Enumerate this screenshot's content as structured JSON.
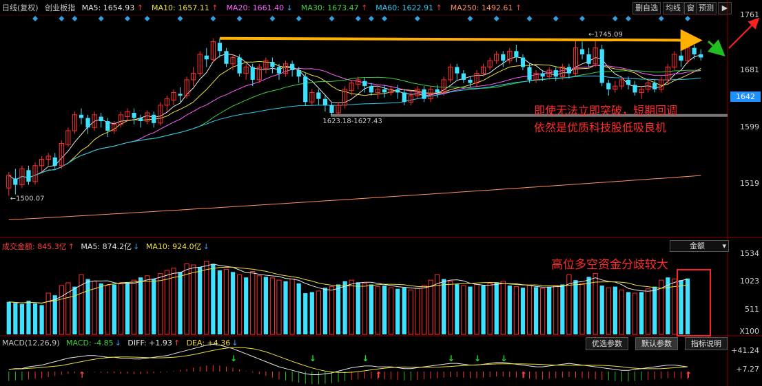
{
  "header": {
    "period": "日线(复权)",
    "symbol": "创业板指",
    "ma": [
      {
        "label": "MA5: 1654.93",
        "arrow": "↑",
        "color": "#e8e8e8"
      },
      {
        "label": "MA10: 1657.11",
        "arrow": "↑",
        "color": "#f0e040"
      },
      {
        "label": "MA20: 1661.40",
        "arrow": "↓",
        "color": "#ff60ff"
      },
      {
        "label": "MA30: 1673.47",
        "arrow": "↑",
        "color": "#40d040"
      },
      {
        "label": "MA60: 1622.91",
        "arrow": "↑",
        "color": "#30c8f0"
      },
      {
        "label": "MA250: 1492.61",
        "arrow": "↑",
        "color": "#ff9060"
      }
    ]
  },
  "toolbar": {
    "delete_self": "删自选",
    "ma_line": "均线",
    "window": "窗",
    "forecast": "预测"
  },
  "price_axis": {
    "ticks": [
      "1761",
      "1681",
      "1599",
      "1519"
    ],
    "current": "1642"
  },
  "volume_header": {
    "label": "成交金额: 845.3亿",
    "ma5": "MA5: 874.2亿",
    "ma10": "MA10: 924.0亿",
    "selector": "金额"
  },
  "volume_axis": {
    "ticks": [
      "1534",
      "1023",
      "511"
    ],
    "unit": "X100"
  },
  "macd_header": {
    "label": "MACD(12,26,9)",
    "macd": "MACD: -4.85",
    "diff": "DIFF: +1.93",
    "dea": "DEA: +4.36"
  },
  "macd_axis": {
    "ticks": [
      "+41.24",
      "+7.27"
    ]
  },
  "tabs": {
    "preferred": "优选参数",
    "default": "默认参数",
    "help": "指标说明"
  },
  "annotations": {
    "line1": "即使无法立即突破，短期回调",
    "line2": "依然是优质科技股低吸良机",
    "volume_note": "高位多空资金分歧较大"
  },
  "chart_data": {
    "type": "candlestick",
    "price_range": [
      1440,
      1775
    ],
    "labels": {
      "high": "1745.09",
      "low": "1500.07",
      "mid_low": "1623.18-1627.43"
    },
    "candles": [
      [
        1510,
        1530,
        1498,
        1535
      ],
      [
        1525,
        1515,
        1500,
        1540
      ],
      [
        1515,
        1540,
        1510,
        1545
      ],
      [
        1538,
        1520,
        1515,
        1545
      ],
      [
        1520,
        1545,
        1515,
        1550
      ],
      [
        1545,
        1555,
        1535,
        1560
      ],
      [
        1555,
        1560,
        1545,
        1565
      ],
      [
        1558,
        1545,
        1540,
        1565
      ],
      [
        1545,
        1580,
        1540,
        1585
      ],
      [
        1578,
        1600,
        1575,
        1605
      ],
      [
        1600,
        1625,
        1595,
        1630
      ],
      [
        1625,
        1620,
        1610,
        1635
      ],
      [
        1620,
        1605,
        1595,
        1625
      ],
      [
        1605,
        1625,
        1600,
        1630
      ],
      [
        1622,
        1615,
        1605,
        1628
      ],
      [
        1615,
        1600,
        1590,
        1620
      ],
      [
        1600,
        1610,
        1595,
        1615
      ],
      [
        1610,
        1625,
        1605,
        1630
      ],
      [
        1622,
        1630,
        1615,
        1635
      ],
      [
        1628,
        1620,
        1610,
        1635
      ],
      [
        1620,
        1615,
        1605,
        1625
      ],
      [
        1615,
        1628,
        1610,
        1632
      ],
      [
        1625,
        1612,
        1605,
        1630
      ],
      [
        1612,
        1640,
        1608,
        1645
      ],
      [
        1640,
        1650,
        1630,
        1655
      ],
      [
        1648,
        1660,
        1640,
        1665
      ],
      [
        1658,
        1655,
        1645,
        1668
      ],
      [
        1655,
        1680,
        1650,
        1685
      ],
      [
        1680,
        1690,
        1670,
        1700
      ],
      [
        1690,
        1720,
        1685,
        1725
      ],
      [
        1718,
        1712,
        1700,
        1730
      ],
      [
        1712,
        1740,
        1708,
        1745
      ],
      [
        1738,
        1725,
        1715,
        1745
      ],
      [
        1725,
        1705,
        1700,
        1730
      ],
      [
        1705,
        1715,
        1695,
        1720
      ],
      [
        1715,
        1690,
        1685,
        1720
      ],
      [
        1690,
        1700,
        1680,
        1705
      ],
      [
        1700,
        1680,
        1670,
        1705
      ],
      [
        1680,
        1700,
        1675,
        1705
      ],
      [
        1698,
        1710,
        1690,
        1715
      ],
      [
        1708,
        1700,
        1690,
        1715
      ],
      [
        1700,
        1690,
        1680,
        1705
      ],
      [
        1690,
        1705,
        1685,
        1710
      ],
      [
        1705,
        1695,
        1685,
        1710
      ],
      [
        1695,
        1685,
        1675,
        1700
      ],
      [
        1685,
        1645,
        1640,
        1690
      ],
      [
        1645,
        1660,
        1640,
        1665
      ],
      [
        1660,
        1650,
        1640,
        1665
      ],
      [
        1650,
        1640,
        1630,
        1655
      ],
      [
        1640,
        1628,
        1625,
        1645
      ],
      [
        1628,
        1640,
        1623,
        1645
      ],
      [
        1640,
        1665,
        1635,
        1670
      ],
      [
        1663,
        1675,
        1655,
        1680
      ],
      [
        1673,
        1680,
        1665,
        1685
      ],
      [
        1678,
        1670,
        1660,
        1683
      ],
      [
        1670,
        1660,
        1655,
        1675
      ],
      [
        1660,
        1665,
        1650,
        1670
      ],
      [
        1665,
        1660,
        1652,
        1672
      ],
      [
        1660,
        1665,
        1655,
        1670
      ],
      [
        1665,
        1660,
        1650,
        1672
      ],
      [
        1660,
        1645,
        1640,
        1665
      ],
      [
        1645,
        1655,
        1640,
        1660
      ],
      [
        1655,
        1665,
        1650,
        1670
      ],
      [
        1665,
        1650,
        1645,
        1670
      ],
      [
        1650,
        1665,
        1645,
        1670
      ],
      [
        1665,
        1660,
        1652,
        1672
      ],
      [
        1660,
        1680,
        1655,
        1685
      ],
      [
        1680,
        1700,
        1675,
        1705
      ],
      [
        1700,
        1690,
        1680,
        1705
      ],
      [
        1690,
        1680,
        1675,
        1695
      ],
      [
        1680,
        1675,
        1668,
        1685
      ],
      [
        1675,
        1690,
        1670,
        1695
      ],
      [
        1690,
        1700,
        1685,
        1705
      ],
      [
        1700,
        1710,
        1695,
        1715
      ],
      [
        1710,
        1720,
        1705,
        1725
      ],
      [
        1720,
        1710,
        1700,
        1725
      ],
      [
        1710,
        1725,
        1705,
        1730
      ],
      [
        1725,
        1715,
        1708,
        1735
      ],
      [
        1715,
        1700,
        1695,
        1720
      ],
      [
        1700,
        1680,
        1675,
        1705
      ],
      [
        1680,
        1690,
        1675,
        1695
      ],
      [
        1690,
        1685,
        1678,
        1695
      ],
      [
        1685,
        1695,
        1680,
        1700
      ],
      [
        1695,
        1685,
        1678,
        1700
      ],
      [
        1685,
        1700,
        1680,
        1705
      ],
      [
        1700,
        1690,
        1682,
        1705
      ],
      [
        1690,
        1730,
        1685,
        1745
      ],
      [
        1728,
        1720,
        1712,
        1740
      ],
      [
        1720,
        1705,
        1700,
        1730
      ],
      [
        1705,
        1730,
        1700,
        1745
      ],
      [
        1728,
        1675,
        1670,
        1735
      ],
      [
        1675,
        1665,
        1655,
        1680
      ],
      [
        1665,
        1670,
        1660,
        1678
      ],
      [
        1670,
        1680,
        1665,
        1685
      ],
      [
        1680,
        1672,
        1665,
        1685
      ],
      [
        1672,
        1660,
        1655,
        1678
      ],
      [
        1660,
        1665,
        1650,
        1670
      ],
      [
        1665,
        1675,
        1660,
        1680
      ],
      [
        1675,
        1665,
        1660,
        1680
      ],
      [
        1665,
        1680,
        1660,
        1685
      ],
      [
        1680,
        1700,
        1675,
        1705
      ],
      [
        1700,
        1720,
        1695,
        1725
      ],
      [
        1718,
        1710,
        1700,
        1725
      ],
      [
        1710,
        1730,
        1705,
        1735
      ],
      [
        1730,
        1720,
        1712,
        1735
      ],
      [
        1720,
        1715,
        1710,
        1728
      ]
    ],
    "volume": [
      [
        600,
        1
      ],
      [
        580,
        1
      ],
      [
        560,
        1
      ],
      [
        620,
        1
      ],
      [
        570,
        1
      ],
      [
        540,
        1
      ],
      [
        760,
        0
      ],
      [
        720,
        1
      ],
      [
        900,
        0
      ],
      [
        950,
        0
      ],
      [
        880,
        1
      ],
      [
        1100,
        0
      ],
      [
        1020,
        1
      ],
      [
        980,
        0
      ],
      [
        940,
        1
      ],
      [
        900,
        0
      ],
      [
        920,
        1
      ],
      [
        930,
        0
      ],
      [
        960,
        1
      ],
      [
        1000,
        0
      ],
      [
        1050,
        1
      ],
      [
        1080,
        0
      ],
      [
        1020,
        1
      ],
      [
        1120,
        0
      ],
      [
        1180,
        0
      ],
      [
        1220,
        0
      ],
      [
        1150,
        1
      ],
      [
        1300,
        0
      ],
      [
        1280,
        0
      ],
      [
        1240,
        1
      ],
      [
        1350,
        0
      ],
      [
        1300,
        1
      ],
      [
        1180,
        1
      ],
      [
        1200,
        0
      ],
      [
        1150,
        1
      ],
      [
        1100,
        0
      ],
      [
        1050,
        1
      ],
      [
        1160,
        0
      ],
      [
        1080,
        0
      ],
      [
        1060,
        1
      ],
      [
        1040,
        0
      ],
      [
        1000,
        0
      ],
      [
        980,
        1
      ],
      [
        1020,
        0
      ],
      [
        940,
        1
      ],
      [
        760,
        1
      ],
      [
        780,
        1
      ],
      [
        800,
        0
      ],
      [
        860,
        1
      ],
      [
        880,
        0
      ],
      [
        920,
        1
      ],
      [
        980,
        1
      ],
      [
        1000,
        0
      ],
      [
        960,
        1
      ],
      [
        940,
        0
      ],
      [
        920,
        1
      ],
      [
        880,
        0
      ],
      [
        900,
        1
      ],
      [
        860,
        0
      ],
      [
        840,
        1
      ],
      [
        860,
        1
      ],
      [
        820,
        0
      ],
      [
        850,
        0
      ],
      [
        900,
        0
      ],
      [
        1000,
        0
      ],
      [
        1100,
        0
      ],
      [
        1020,
        1
      ],
      [
        980,
        0
      ],
      [
        930,
        1
      ],
      [
        900,
        0
      ],
      [
        880,
        1
      ],
      [
        920,
        0
      ],
      [
        900,
        1
      ],
      [
        940,
        0
      ],
      [
        960,
        1
      ],
      [
        980,
        0
      ],
      [
        900,
        1
      ],
      [
        880,
        0
      ],
      [
        860,
        1
      ],
      [
        900,
        0
      ],
      [
        870,
        1
      ],
      [
        850,
        0
      ],
      [
        880,
        1
      ],
      [
        900,
        0
      ],
      [
        920,
        1
      ],
      [
        1100,
        0
      ],
      [
        1000,
        1
      ],
      [
        940,
        0
      ],
      [
        1060,
        1
      ],
      [
        1120,
        0
      ],
      [
        900,
        1
      ],
      [
        860,
        0
      ],
      [
        880,
        1
      ],
      [
        820,
        0
      ],
      [
        780,
        1
      ],
      [
        760,
        0
      ],
      [
        780,
        1
      ],
      [
        840,
        0
      ],
      [
        880,
        1
      ],
      [
        1000,
        0
      ],
      [
        1050,
        1
      ],
      [
        1020,
        0
      ],
      [
        1000,
        1
      ],
      [
        1030,
        1
      ]
    ],
    "macd": [
      -2,
      -1,
      -1,
      1,
      2,
      3,
      5,
      7,
      9,
      11,
      12,
      13,
      14,
      14,
      13,
      12,
      12,
      11,
      11,
      10,
      10,
      11,
      12,
      13,
      14,
      16,
      18,
      20,
      22,
      24,
      26,
      27,
      26,
      24,
      22,
      19,
      16,
      13,
      10,
      7,
      4,
      1,
      -1,
      -3,
      -5,
      -7,
      -8,
      -8,
      -7,
      -6,
      -4,
      -2,
      0,
      1,
      2,
      2,
      1,
      1,
      1,
      0,
      -1,
      -1,
      0,
      1,
      2,
      3,
      4,
      5,
      5,
      4,
      3,
      3,
      4,
      5,
      6,
      6,
      5,
      4,
      3,
      2,
      1,
      1,
      2,
      3,
      4,
      5,
      4,
      3,
      2,
      1,
      0,
      -1,
      -2,
      -3,
      -3,
      -2,
      -1,
      0,
      1,
      2,
      3,
      3,
      2,
      1
    ],
    "markers": {
      "diamond_top": [
        4,
        8,
        10,
        14,
        18,
        21,
        26,
        31,
        35,
        40,
        44,
        49,
        53,
        55,
        57,
        62,
        70,
        74,
        79,
        83,
        87,
        92,
        94,
        99,
        103
      ],
      "macd_up": [
        11,
        78,
        103
      ],
      "macd_down": [
        34,
        46,
        54,
        67,
        71,
        75
      ],
      "macd_up2": [
        56
      ]
    }
  }
}
